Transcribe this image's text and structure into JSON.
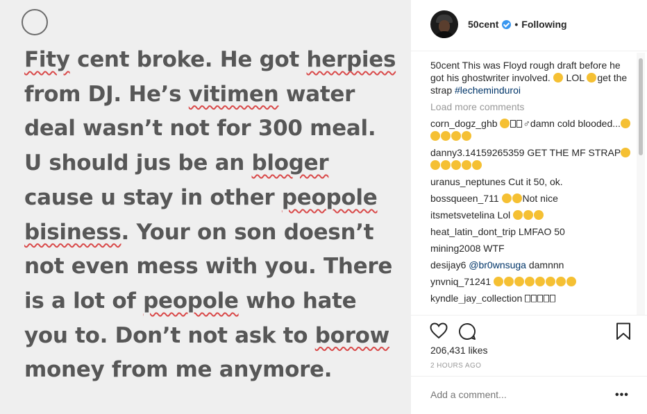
{
  "note": {
    "lines": [
      [
        {
          "t": "Fity",
          "m": true
        },
        {
          "t": " cent broke. He got "
        },
        {
          "t": "herpies",
          "m": true
        }
      ],
      [
        {
          "t": "from DJ. He’s "
        },
        {
          "t": "vitimen",
          "m": true
        },
        {
          "t": " water"
        }
      ],
      [
        {
          "t": "deal wasn’t not for 300 meal."
        }
      ],
      [
        {
          "t": "U should jus be an "
        },
        {
          "t": "bloger",
          "m": true
        }
      ],
      [
        {
          "t": "cause u stay in other "
        },
        {
          "t": "peopole",
          "m": true
        }
      ],
      [
        {
          "t": "bisiness",
          "m": true
        },
        {
          "t": ". Your on son doesn’t"
        }
      ],
      [
        {
          "t": "not even mess with you. There"
        }
      ],
      [
        {
          "t": "is a lot of "
        },
        {
          "t": "peopole",
          "m": true
        },
        {
          "t": " who hate"
        }
      ],
      [
        {
          "t": "you to. Don’t not ask to "
        },
        {
          "t": "borow",
          "m": true
        }
      ],
      [
        {
          "t": "money from me anymore."
        }
      ]
    ]
  },
  "header": {
    "username": "50cent",
    "separator": "•",
    "follow_status": "Following"
  },
  "caption": {
    "username": "50cent",
    "text_1": " This was Floyd rough draft before he got his ghostwriter involved. ",
    "text_2": " LOL ",
    "text_3": "get the strap ",
    "hashtag": "#lecheminduroi"
  },
  "load_more": "Load more comments",
  "comments": [
    {
      "user": "corn_dogz_ghb",
      "pre": " ",
      "text": "damn cold blooded...",
      "emoji_before": 1,
      "boxes": 2,
      "after_char": "♂",
      "emoji_after": 5
    },
    {
      "user": "danny3.14159265359",
      "text": " GET THE MF STRAP",
      "emoji_after": 6
    },
    {
      "user": "uranus_neptunes",
      "text": " Cut it 50, ok.",
      "emoji_after": 0
    },
    {
      "user": "bossqueen_711",
      "text": " ",
      "emoji_before_text": 2,
      "text2": "Not nice"
    },
    {
      "user": "itsmetsvetelina",
      "text": " Lol ",
      "emoji_after": 3
    },
    {
      "user": "heat_latin_dont_trip",
      "text": " LMFAO 50",
      "emoji_after": 0
    },
    {
      "user": "mining2008",
      "text": " WTF",
      "emoji_after": 0
    },
    {
      "user": "desijay6",
      "text": " ",
      "mention": "@br0wnsuga",
      "text2": " damnnn"
    },
    {
      "user": "ynvniq_71241",
      "text": " ",
      "emoji_after": 8
    },
    {
      "user": "kyndle_jay_collection",
      "text": " ",
      "boxes": 5
    }
  ],
  "likes": "206,431 likes",
  "timestamp": "2 HOURS AGO",
  "add_comment_placeholder": "Add a comment...",
  "more_options": "•••",
  "colors": {
    "link": "#003569",
    "verified": "#3897f0",
    "muted": "#999999",
    "misspell_underline": "#d94a4a",
    "note_text": "#575757"
  }
}
